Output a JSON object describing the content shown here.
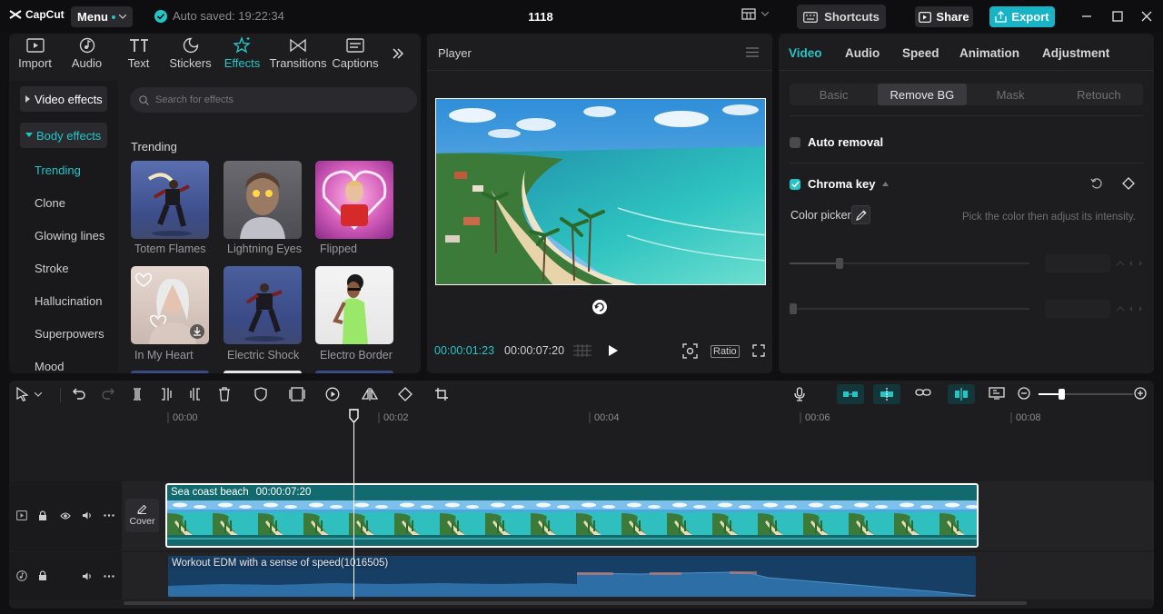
{
  "app": {
    "logo_text": "CapCut",
    "menu_label": "Menu",
    "autosave_text": "Auto saved: 19:22:34",
    "project_title": "1118",
    "shortcuts_label": "Shortcuts",
    "share_label": "Share",
    "export_label": "Export"
  },
  "tool_tabs": [
    {
      "label": "Import",
      "icon": "import-icon"
    },
    {
      "label": "Audio",
      "icon": "audio-icon"
    },
    {
      "label": "Text",
      "icon": "text-icon"
    },
    {
      "label": "Stickers",
      "icon": "stickers-icon"
    },
    {
      "label": "Effects",
      "icon": "effects-icon",
      "active": true
    },
    {
      "label": "Transitions",
      "icon": "transitions-icon"
    },
    {
      "label": "Captions",
      "icon": "captions-icon"
    }
  ],
  "effects": {
    "video_effects_label": "Video effects",
    "body_effects_label": "Body effects",
    "categories": [
      "Trending",
      "Clone",
      "Glowing lines",
      "Stroke",
      "Hallucination",
      "Superpowers",
      "Mood"
    ],
    "search_placeholder": "Search for effects",
    "section_title": "Trending",
    "items": [
      "Totem Flames",
      "Lightning Eyes",
      "Flipped",
      "In My Heart",
      "Electric Shock",
      "Electro Border"
    ]
  },
  "player": {
    "title": "Player",
    "current_time": "00:00:01:23",
    "total_time": "00:00:07:20",
    "ratio_label": "Ratio"
  },
  "inspector": {
    "tabs": [
      "Video",
      "Audio",
      "Speed",
      "Animation",
      "Adjustment"
    ],
    "subtabs": [
      "Basic",
      "Remove BG",
      "Mask",
      "Retouch"
    ],
    "auto_removal_label": "Auto removal",
    "chroma_key_label": "Chroma key",
    "color_picker_label": "Color picker",
    "color_picker_hint": "Pick the color then adjust its intensity."
  },
  "timeline": {
    "ruler_labels": [
      "00:00",
      "00:02",
      "00:04",
      "00:06",
      "00:08"
    ],
    "cover_label": "Cover",
    "video_clip_name": "Sea coast beach",
    "video_clip_duration": "00:00:07:20",
    "audio_clip_name": "Workout EDM with a sense of speed(1016505)"
  },
  "colors": {
    "accent": "#23c5c7",
    "export_bg": "#19b3c6",
    "video_clip_bg": "#126a6f",
    "audio_clip_bg": "#173f66"
  }
}
